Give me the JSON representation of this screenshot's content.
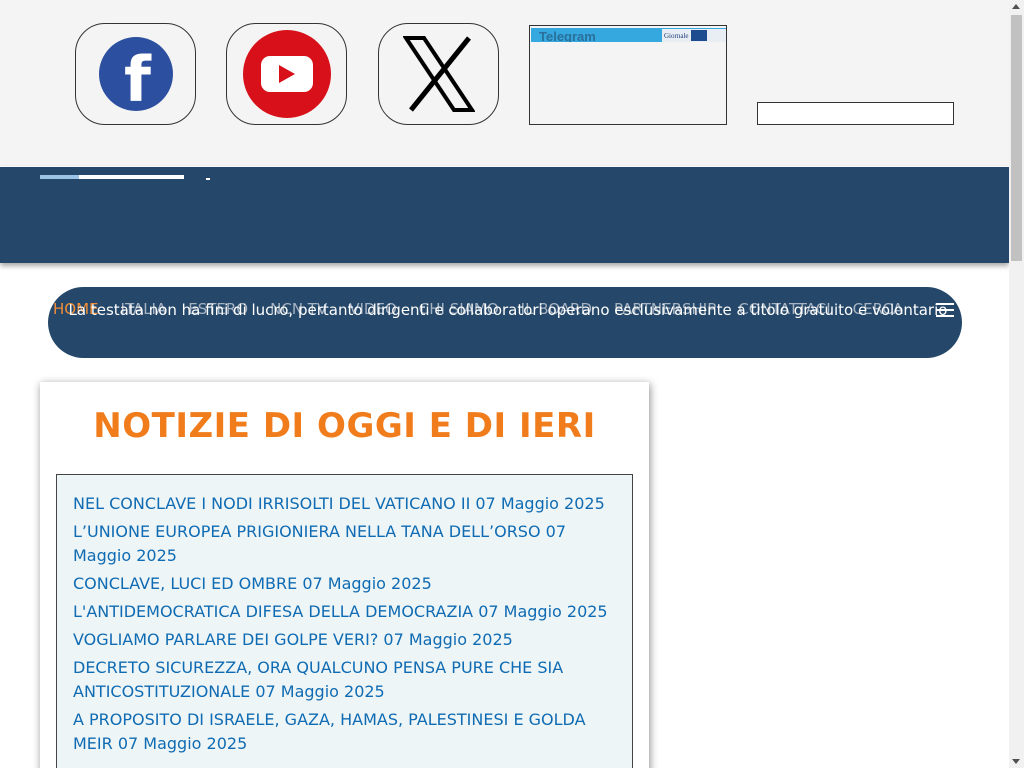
{
  "social": {
    "facebook": {
      "icon": "facebook-icon",
      "glyph": "f",
      "color": "#2d4fa0"
    },
    "youtube": {
      "icon": "youtube-icon",
      "color": "#d7101a"
    },
    "x": {
      "icon": "x-icon",
      "color": "#000000"
    }
  },
  "telegram": {
    "label": "Telegram",
    "logo_text": "Giornale",
    "strip_color": "#35a8df"
  },
  "search": {
    "value": "",
    "placeholder": ""
  },
  "nav": {
    "items": [
      "HOME",
      "ITALIA",
      "ESTERO",
      "NCN TV",
      "VIDEO",
      "CHI SIAMO",
      "IL BOARD",
      "PARTNERSHIP",
      "CONTATTACI",
      "CERCA"
    ],
    "overlay_text": "La testata non ha fini di lucro, pertanto dirigenti e collaboratori operano esclusivamente a titolo gratuito e volontario",
    "active_color": "#f18d37",
    "background": "#254769"
  },
  "news": {
    "title": "NOTIZIE DI OGGI E DI IERI",
    "items": [
      "NEL CONCLAVE I NODI IRRISOLTI DEL VATICANO II 07 Maggio 2025",
      "L’UNIONE EUROPEA PRIGIONIERA NELLA TANA DELL’ORSO 07 Maggio 2025",
      "CONCLAVE, LUCI ED OMBRE 07 Maggio 2025",
      "L'ANTIDEMOCRATICA DIFESA DELLA DEMOCRAZIA 07 Maggio 2025",
      "VOGLIAMO PARLARE DEI GOLPE VERI? 07 Maggio 2025",
      "DECRETO SICUREZZA, ORA QUALCUNO PENSA PURE CHE SIA ANTICOSTITUZIONALE 07 Maggio 2025",
      "A PROPOSITO DI ISRAELE, GAZA, HAMAS, PALESTINESI E GOLDA MEIR 07 Maggio 2025"
    ],
    "title_color": "#f07c1c",
    "link_color": "#0f6bb3"
  }
}
